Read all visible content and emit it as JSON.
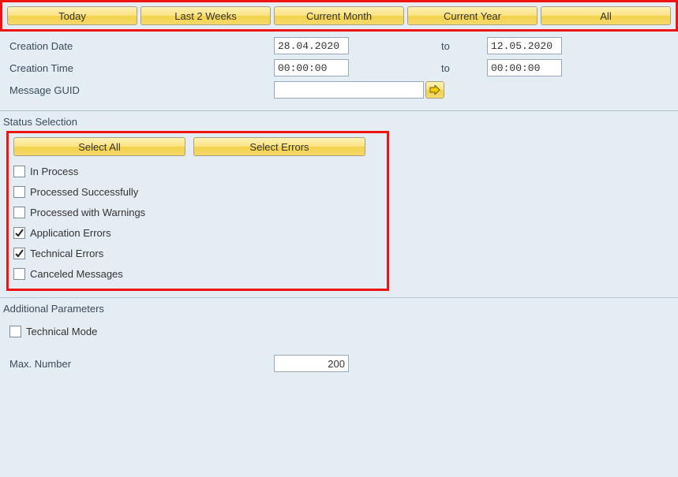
{
  "toolbar": {
    "buttons": [
      "Today",
      "Last 2 Weeks",
      "Current Month",
      "Current Year",
      "All"
    ]
  },
  "dateFilter": {
    "creationDateLabel": "Creation Date",
    "creationDateFrom": "28.04.2020",
    "creationDateTo": "12.05.2020",
    "toLabel1": "to",
    "creationTimeLabel": "Creation Time",
    "creationTimeFrom": "00:00:00",
    "creationTimeTo": "00:00:00",
    "toLabel2": "to",
    "messageGuidLabel": "Message GUID",
    "messageGuidValue": ""
  },
  "statusSelection": {
    "header": "Status Selection",
    "selectAllLabel": "Select All",
    "selectErrorsLabel": "Select Errors",
    "items": [
      {
        "label": "In Process",
        "checked": false
      },
      {
        "label": "Processed Successfully",
        "checked": false
      },
      {
        "label": "Processed with Warnings",
        "checked": false
      },
      {
        "label": "Application Errors",
        "checked": true
      },
      {
        "label": "Technical Errors",
        "checked": true
      },
      {
        "label": "Canceled Messages",
        "checked": false
      }
    ]
  },
  "additionalParams": {
    "header": "Additional Parameters",
    "technicalModeLabel": "Technical Mode",
    "technicalModeChecked": false,
    "maxNumberLabel": "Max. Number",
    "maxNumberValue": "200"
  }
}
